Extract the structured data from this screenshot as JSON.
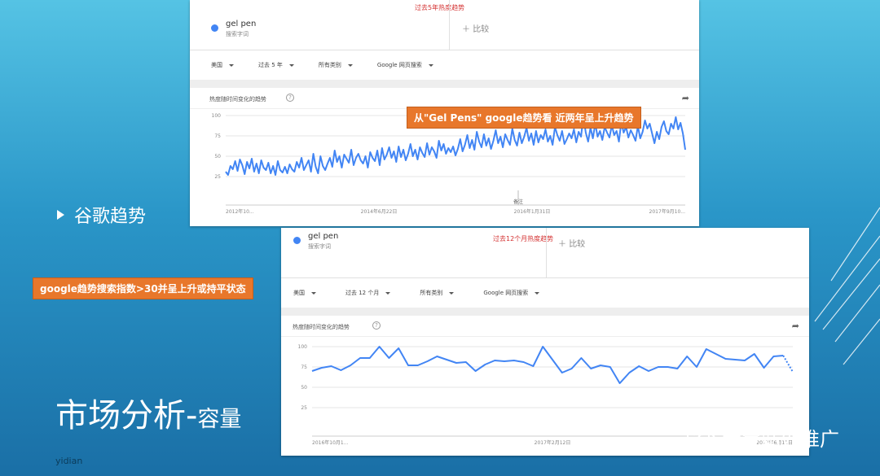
{
  "slide": {
    "bullet": "谷歌趋势",
    "title_main": "市场分析-",
    "title_sub": "容量",
    "footer_left": "yidian",
    "watermark": "大宝站外推广",
    "banner_left": "google趋势搜索指数>30并呈上升或持平状态",
    "banner_top": "从\"Gel Pens\" google趋势看 近两年呈上升趋势",
    "colors": {
      "banner": "#e8772b",
      "line": "#4285f4",
      "note": "#d32f2f"
    }
  },
  "panel1": {
    "note": "过去5年热度趋势",
    "term": "gel pen",
    "term_sub": "搜索字词",
    "compare": "比较",
    "filters": [
      "美国",
      "过去 5 年",
      "所有类别",
      "Google 网页搜索"
    ],
    "chart_title": "热度随时间变化的趋势",
    "note_label": "备注",
    "x_labels": [
      "2012年10...",
      "2014年6月22日",
      "2016年1月31日",
      "2017年9月10..."
    ]
  },
  "panel2": {
    "note": "过去12个月热度趋势",
    "term": "gel pen",
    "term_sub": "搜索字词",
    "compare": "比较",
    "filters": [
      "美国",
      "过去 12 个月",
      "所有类别",
      "Google 网页搜索"
    ],
    "chart_title": "热度随时间变化的趋势",
    "x_labels": [
      "2016年10月1...",
      "2017年2月12日",
      "2017年6月11日"
    ]
  },
  "chart_data": [
    {
      "type": "line",
      "title": "热度随时间变化的趋势",
      "ylim": [
        0,
        100
      ],
      "yticks": [
        25,
        50,
        75,
        100
      ],
      "x_labels": [
        "2012年10...",
        "2014年6月22日",
        "2016年1月31日",
        "2017年9月10..."
      ],
      "series": [
        {
          "name": "gel pen",
          "values": [
            31,
            27,
            38,
            34,
            44,
            32,
            46,
            39,
            28,
            43,
            35,
            47,
            31,
            41,
            29,
            45,
            36,
            33,
            42,
            29,
            38,
            27,
            44,
            33,
            30,
            37,
            29,
            40,
            34,
            31,
            43,
            36,
            48,
            33,
            39,
            45,
            31,
            53,
            37,
            29,
            50,
            38,
            33,
            41,
            48,
            37,
            57,
            43,
            50,
            36,
            52,
            47,
            42,
            58,
            39,
            48,
            53,
            45,
            41,
            50,
            36,
            55,
            48,
            44,
            57,
            39,
            60,
            46,
            52,
            61,
            48,
            56,
            43,
            62,
            49,
            58,
            45,
            53,
            65,
            50,
            58,
            46,
            61,
            54,
            49,
            66,
            52,
            61,
            56,
            48,
            69,
            57,
            65,
            53,
            60,
            55,
            62,
            51,
            59,
            71,
            56,
            64,
            76,
            60,
            70,
            58,
            80,
            68,
            61,
            77,
            63,
            72,
            59,
            69,
            82,
            66,
            74,
            61,
            77,
            70,
            64,
            84,
            70,
            63,
            79,
            66,
            74,
            85,
            69,
            78,
            64,
            81,
            67,
            76,
            71,
            83,
            68,
            75,
            64,
            86,
            76,
            69,
            81,
            65,
            71,
            78,
            72,
            83,
            67,
            80,
            74,
            99,
            79,
            68,
            85,
            72,
            90,
            74,
            81,
            70,
            86,
            79,
            73,
            88,
            76,
            81,
            68,
            92,
            79,
            86,
            73,
            82,
            76,
            69,
            87,
            72,
            80,
            94,
            84,
            90,
            78,
            66,
            80,
            71,
            86,
            93,
            81,
            77,
            90,
            84,
            98,
            83,
            91,
            78,
            58
          ]
        }
      ]
    },
    {
      "type": "line",
      "title": "热度随时间变化的趋势",
      "ylim": [
        0,
        100
      ],
      "yticks": [
        25,
        50,
        75,
        100
      ],
      "x_labels": [
        "2016年10月1...",
        "2017年2月12日",
        "2017年6月11日"
      ],
      "series": [
        {
          "name": "gel pen",
          "values": [
            70,
            74,
            76,
            71,
            77,
            86,
            86,
            100,
            86,
            98,
            77,
            77,
            82,
            88,
            84,
            80,
            81,
            70,
            78,
            83,
            82,
            83,
            81,
            76,
            100,
            84,
            68,
            73,
            86,
            73,
            77,
            75,
            55,
            68,
            76,
            70,
            75,
            75,
            73,
            88,
            75,
            97,
            91,
            85,
            84,
            83,
            91,
            74,
            88,
            89,
            69
          ]
        }
      ]
    }
  ]
}
